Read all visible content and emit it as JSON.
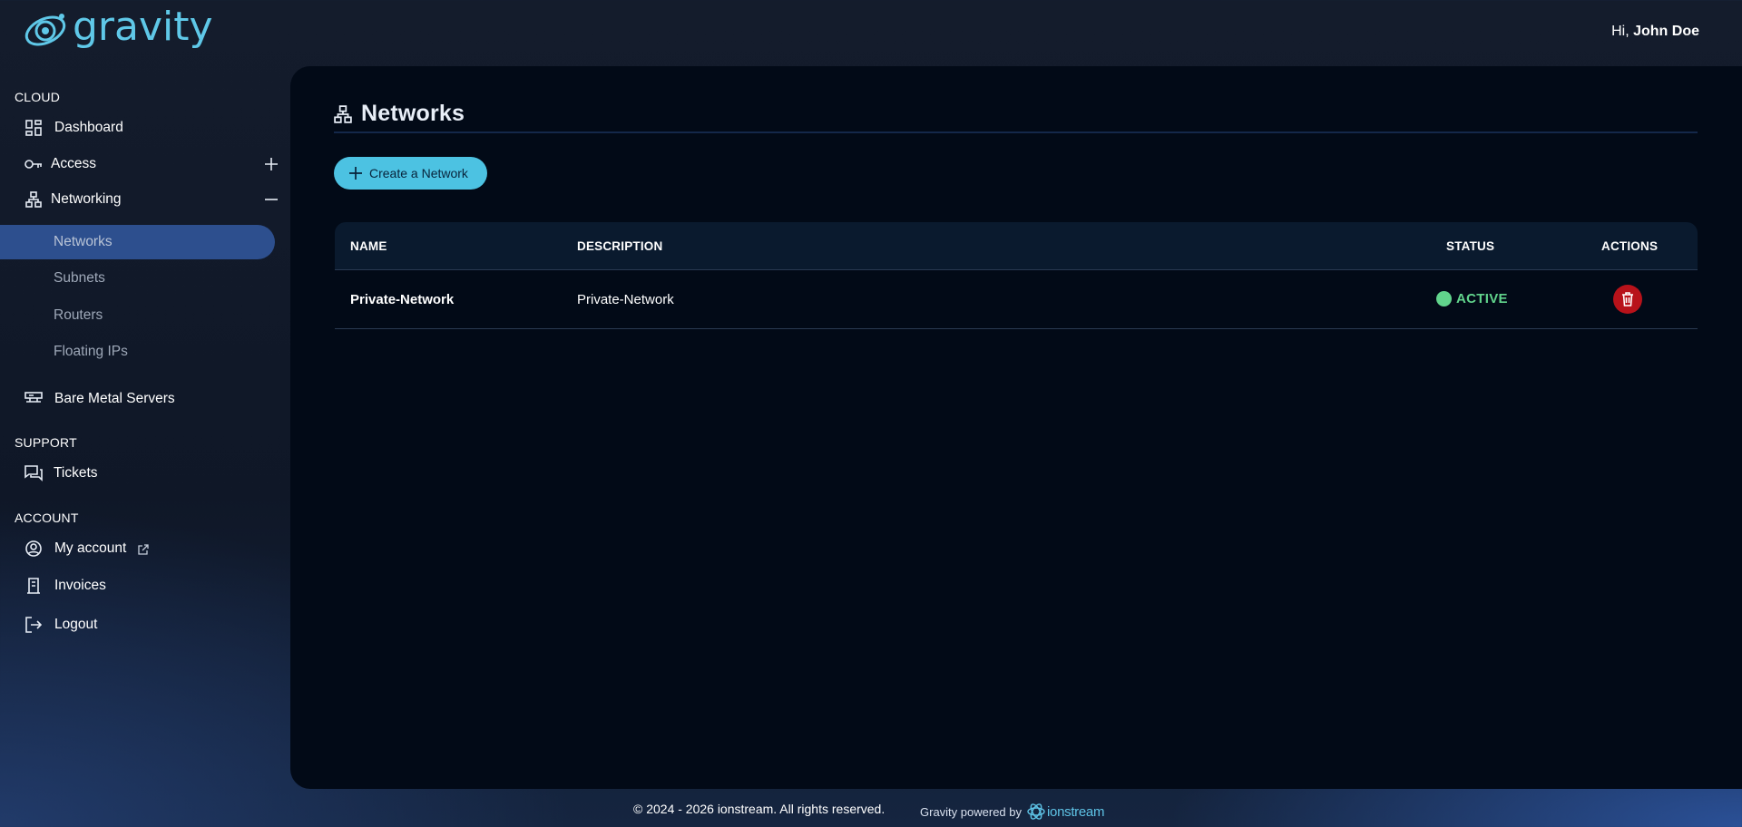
{
  "header": {
    "logo_text": "gravity",
    "greeting_prefix": "Hi,",
    "user_name": "John Doe"
  },
  "sidebar": {
    "sections": {
      "cloud": "CLOUD",
      "support": "SUPPORT",
      "account": "ACCOUNT"
    },
    "items": {
      "dashboard": "Dashboard",
      "access": "Access",
      "networking": "Networking",
      "networks": "Networks",
      "subnets": "Subnets",
      "routers": "Routers",
      "floating_ips": "Floating IPs",
      "bare_metal": "Bare Metal Servers",
      "tickets": "Tickets",
      "my_account": "My account",
      "invoices": "Invoices",
      "logout": "Logout"
    },
    "active_item": "Networks"
  },
  "main": {
    "title": "Networks",
    "create_button": "Create a Network",
    "table": {
      "columns": {
        "name": "NAME",
        "description": "DESCRIPTION",
        "status": "STATUS",
        "actions": "ACTIONS"
      },
      "rows": [
        {
          "name": "Private-Network",
          "description": "Private-Network",
          "status": "ACTIVE"
        }
      ]
    }
  },
  "footer": {
    "copyright": "© 2024 - 2026 ionstream. All rights reserved.",
    "powered_by": "Gravity powered by",
    "brand": "ionstream"
  },
  "colors": {
    "accent": "#4cc2e2",
    "active_nav": "#2d4f8e",
    "status_active": "#61d48c",
    "danger": "#b8121a"
  },
  "icons": {
    "logo": "orbit-icon",
    "dashboard": "grid-icon",
    "access": "key-icon",
    "networking": "network-icon",
    "bare_metal": "server-icon",
    "tickets": "chat-icon",
    "my_account": "user-circle-icon",
    "external": "external-link-icon",
    "invoices": "receipt-icon",
    "logout": "logout-icon",
    "delete": "trash-icon"
  }
}
